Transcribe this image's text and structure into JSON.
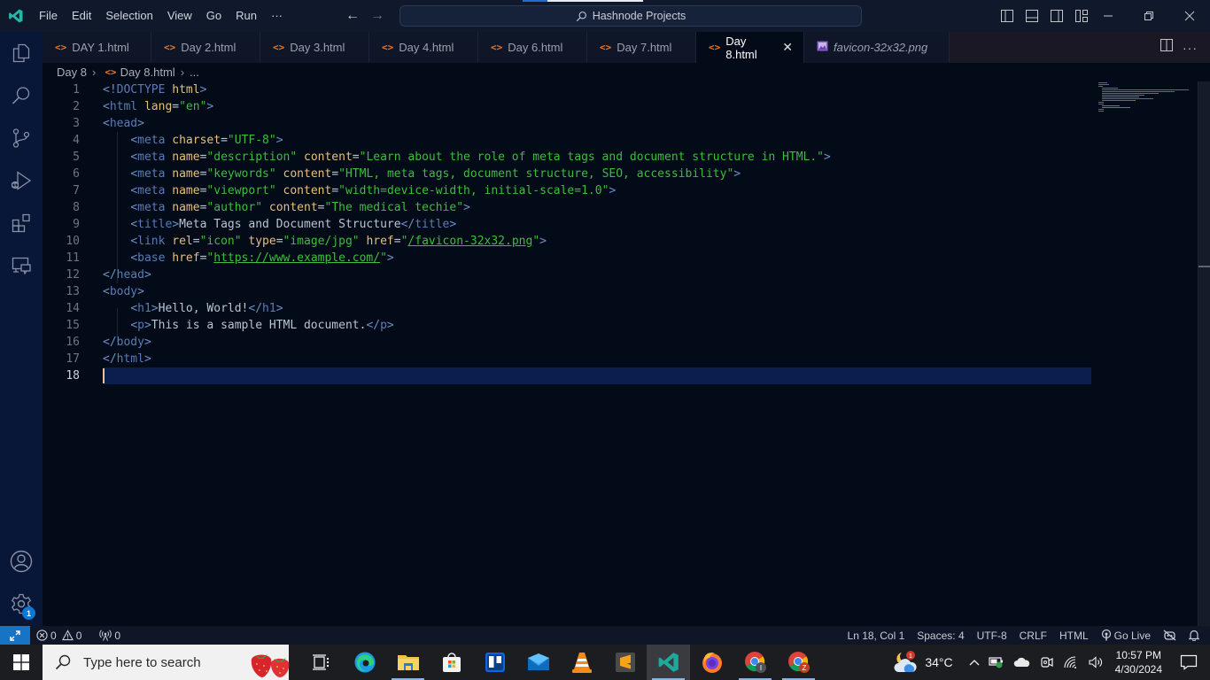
{
  "titlebar": {
    "menu": [
      "File",
      "Edit",
      "Selection",
      "View",
      "Go",
      "Run",
      "···"
    ],
    "command_center": "Hashnode Projects"
  },
  "activity": {
    "items": [
      "explorer-icon",
      "search-icon",
      "source-control-icon",
      "run-debug-icon",
      "extensions-icon",
      "remote-explorer-icon"
    ],
    "accounts": "accounts-icon",
    "settings_badge": "1"
  },
  "tabs": [
    {
      "label": "DAY 1.html",
      "type": "html",
      "active": false
    },
    {
      "label": "Day 2.html",
      "type": "html",
      "active": false
    },
    {
      "label": "Day 3.html",
      "type": "html",
      "active": false
    },
    {
      "label": "Day 4.html",
      "type": "html",
      "active": false
    },
    {
      "label": "Day 6.html",
      "type": "html",
      "active": false
    },
    {
      "label": "Day 7.html",
      "type": "html",
      "active": false
    },
    {
      "label": "Day 8.html",
      "type": "html",
      "active": true
    },
    {
      "label": "favicon-32x32.png",
      "type": "image",
      "active": false
    }
  ],
  "breadcrumb": {
    "folder": "Day 8",
    "file": "Day 8.html",
    "symbol": "..."
  },
  "editor": {
    "current_line": 18,
    "lines": [
      "<!DOCTYPE html>",
      "<html lang=\"en\">",
      "<head>",
      "    <meta charset=\"UTF-8\">",
      "    <meta name=\"description\" content=\"Learn about the role of meta tags and document structure in HTML.\">",
      "    <meta name=\"keywords\" content=\"HTML, meta tags, document structure, SEO, accessibility\">",
      "    <meta name=\"viewport\" content=\"width=device-width, initial-scale=1.0\">",
      "    <meta name=\"author\" content=\"The medical techie\">",
      "    <title>Meta Tags and Document Structure</title>",
      "    <link rel=\"icon\" type=\"image/jpg\" href=\"/favicon-32x32.png\">",
      "    <base href=\"https://www.example.com/\">",
      "</head>",
      "<body>",
      "    <h1>Hello, World!</h1>",
      "    <p>This is a sample HTML document.</p>",
      "</body>",
      "</html>",
      ""
    ]
  },
  "statusbar": {
    "errors": "0",
    "warnings": "0",
    "ports": "0",
    "position": "Ln 18, Col 1",
    "indent": "Spaces: 4",
    "encoding": "UTF-8",
    "eol": "CRLF",
    "language": "HTML",
    "go_live": "Go Live"
  },
  "taskbar": {
    "search_placeholder": "Type here to search",
    "apps": [
      "task-view",
      "edge",
      "file-explorer",
      "microsoft-store",
      "trello",
      "mail",
      "vlc",
      "sublime-text",
      "vscode",
      "firefox",
      "chrome-profile-1",
      "chrome-profile-2"
    ],
    "weather": "34°C",
    "weather_badge": "1",
    "time": "10:57 PM",
    "date": "4/30/2024"
  },
  "colors": {
    "accent": "#1773c4",
    "tag": "#5a7bb8",
    "attr": "#e6c07b",
    "string": "#3dbd3d",
    "html_file_icon": "#e37933"
  }
}
